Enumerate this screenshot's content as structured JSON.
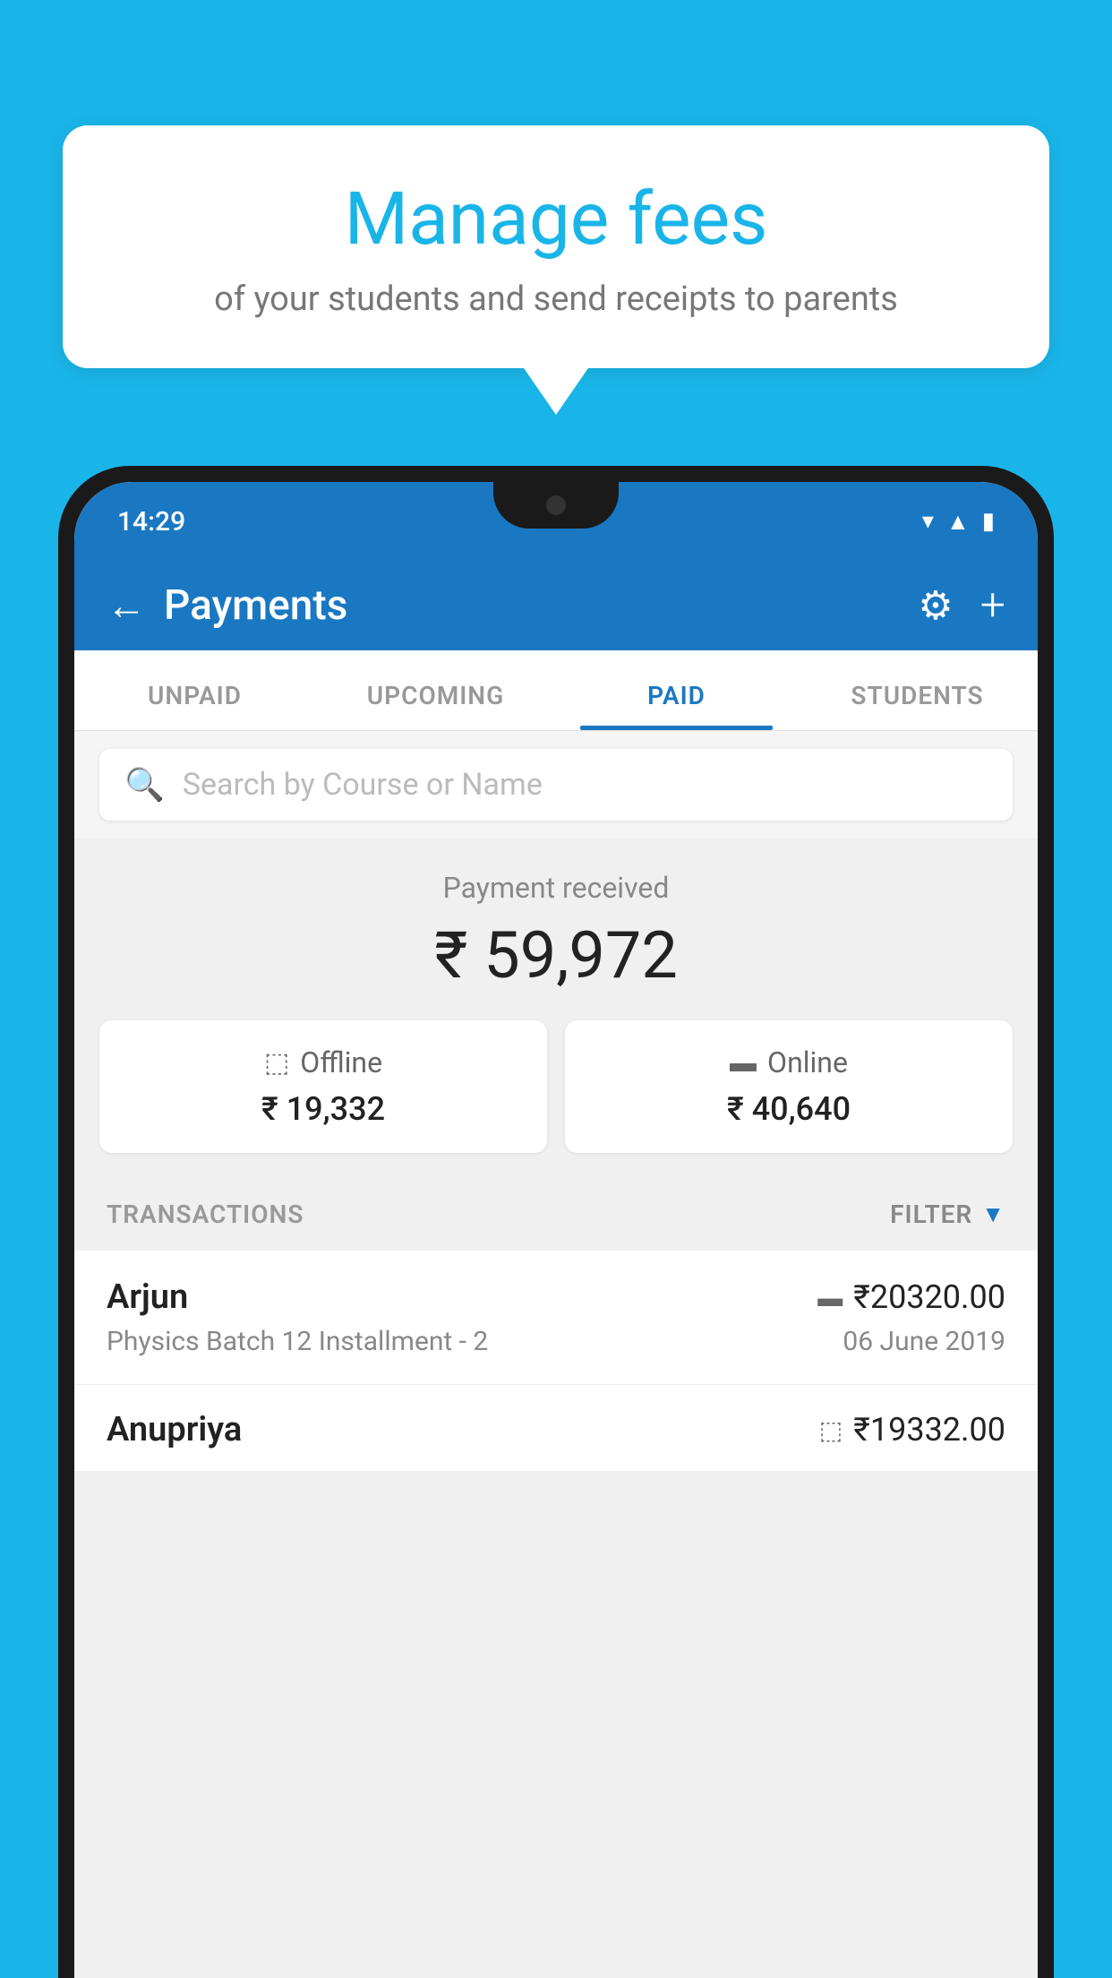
{
  "background_color": "#1ab5e8",
  "bubble": {
    "title": "Manage fees",
    "subtitle": "of your students and send receipts to parents"
  },
  "phone": {
    "status_bar": {
      "time": "14:29"
    },
    "header": {
      "title": "Payments",
      "back_label": "←",
      "settings_icon": "gear",
      "add_icon": "+"
    },
    "tabs": [
      {
        "label": "UNPAID",
        "active": false
      },
      {
        "label": "UPCOMING",
        "active": false
      },
      {
        "label": "PAID",
        "active": true
      },
      {
        "label": "STUDENTS",
        "active": false
      }
    ],
    "search": {
      "placeholder": "Search by Course or Name"
    },
    "payment_summary": {
      "label": "Payment received",
      "total": "₹ 59,972",
      "offline": {
        "label": "Offline",
        "amount": "₹ 19,332",
        "icon": "wallet"
      },
      "online": {
        "label": "Online",
        "amount": "₹ 40,640",
        "icon": "card"
      }
    },
    "transactions": {
      "header_label": "TRANSACTIONS",
      "filter_label": "FILTER",
      "items": [
        {
          "name": "Arjun",
          "course": "Physics Batch 12 Installment - 2",
          "amount": "₹20320.00",
          "date": "06 June 2019",
          "type_icon": "card"
        },
        {
          "name": "Anupriya",
          "course": "",
          "amount": "₹19332.00",
          "date": "",
          "type_icon": "wallet"
        }
      ]
    }
  }
}
